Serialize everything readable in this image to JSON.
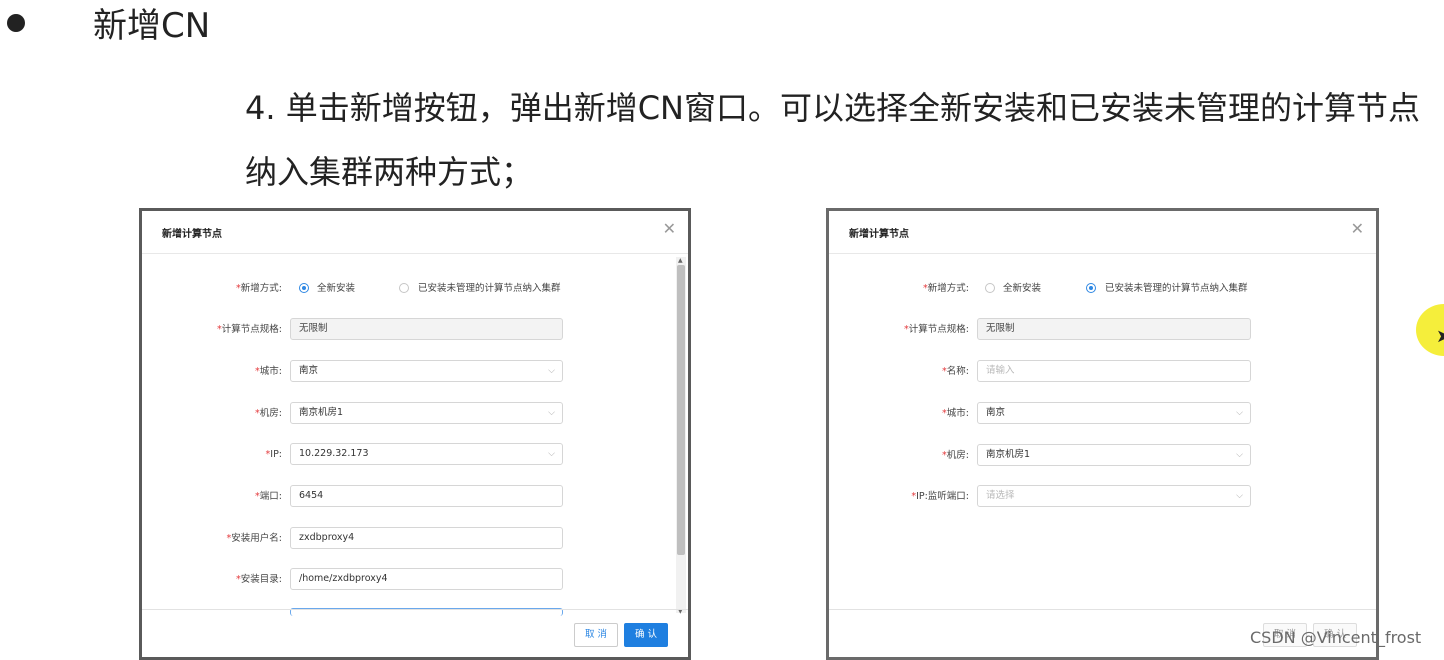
{
  "slide": {
    "title": "新增CN",
    "description": "4. 单击新增按钮，弹出新增CN窗口。可以选择全新安装和已安装未管理的计算节点纳入集群两种方式；"
  },
  "dialog_left": {
    "title": "新增计算节点",
    "close_icon": "close-icon",
    "mode_label": "新增方式:",
    "option_new": "全新安装",
    "option_existing": "已安装未管理的计算节点纳入集群",
    "selected": "全新安装",
    "spec_label": "计算节点规格:",
    "spec_value": "无限制",
    "city_label": "城市:",
    "city_value": "南京",
    "room_label": "机房:",
    "room_value": "南京机房1",
    "ip_label": "IP:",
    "ip_value": "10.229.32.173",
    "port_label": "端口:",
    "port_value": "6454",
    "user_label": "安装用户名:",
    "user_value": "zxdbproxy4",
    "dir_label": "安装目录:",
    "dir_value": "/home/zxdbproxy4",
    "cancel_label": "取 消",
    "confirm_label": "确 认"
  },
  "dialog_right": {
    "title": "新增计算节点",
    "mode_label": "新增方式:",
    "option_new": "全新安装",
    "option_existing": "已安装未管理的计算节点纳入集群",
    "selected": "已安装未管理的计算节点纳入集群",
    "spec_label": "计算节点规格:",
    "spec_value": "无限制",
    "name_label": "名称:",
    "name_placeholder": "请输入",
    "city_label": "城市:",
    "city_value": "南京",
    "room_label": "机房:",
    "room_value": "南京机房1",
    "ipport_label": "IP:监听端口:",
    "ipport_placeholder": "请选择",
    "cancel_label": "取 消",
    "confirm_label": "确 认"
  },
  "watermark": "CSDN @Vincent_frost",
  "colors": {
    "accent": "#1f7fe0",
    "required": "#e4393c",
    "cursor_highlight": "#f5ee3b"
  }
}
